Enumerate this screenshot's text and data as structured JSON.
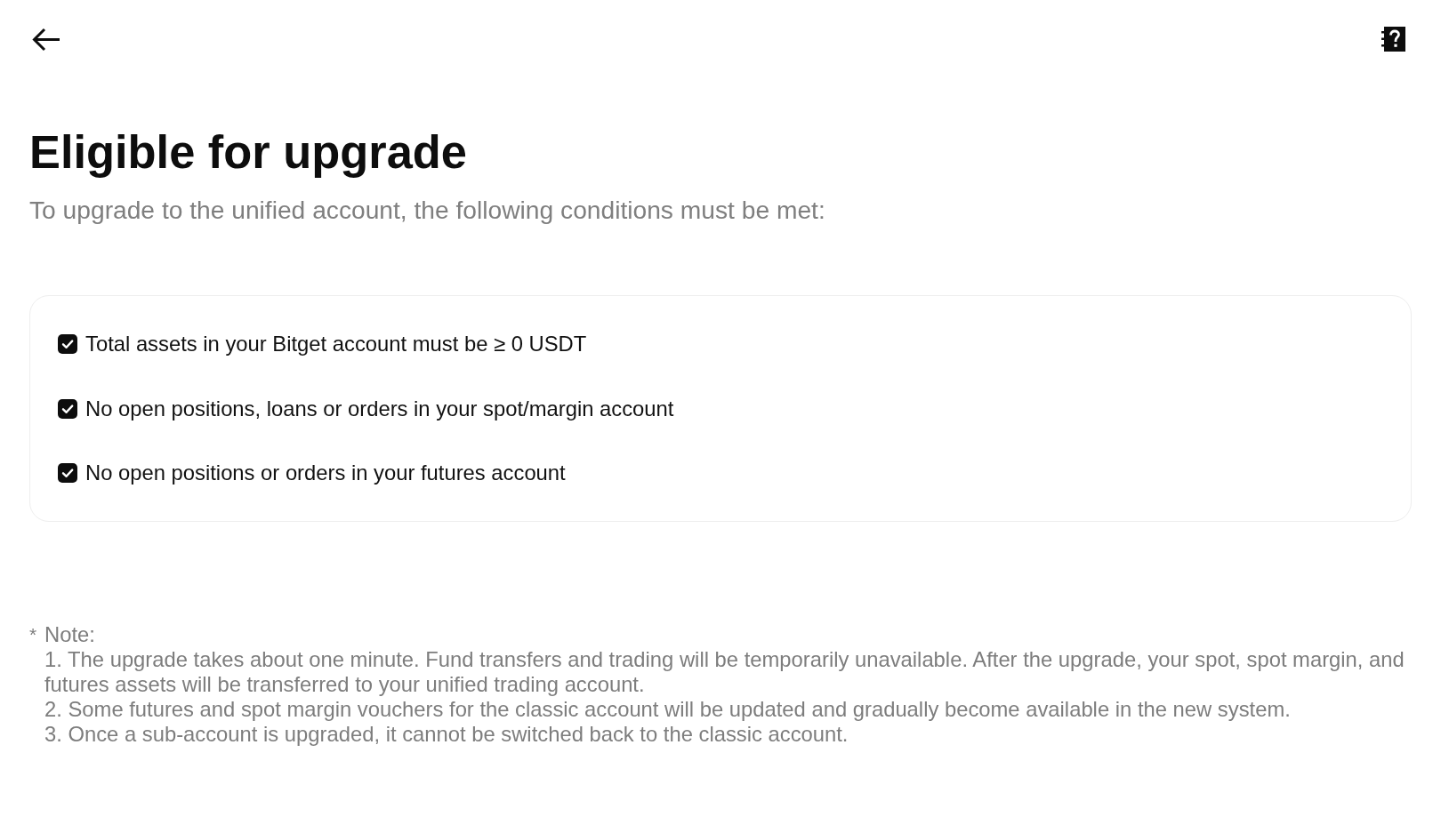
{
  "title": "Eligible for upgrade",
  "subtitle": "To upgrade to the unified account, the following conditions must be met:",
  "conditions": [
    {
      "label": "Total assets in your Bitget account must be ≥ 0 USDT",
      "checked": true
    },
    {
      "label": "No open positions, loans or orders in your spot/margin account",
      "checked": true
    },
    {
      "label": "No open positions or orders in your futures account",
      "checked": true
    }
  ],
  "note": {
    "marker": "*",
    "heading": "Note:",
    "items": [
      "1. The upgrade takes about one minute. Fund transfers and trading will be temporarily unavailable. After the upgrade, your spot, spot margin, and futures assets will be transferred to your unified trading account.",
      "2. Some futures and spot margin vouchers for the classic account will be updated and gradually become available in the new system.",
      "3. Once a sub-account is upgraded, it cannot be switched back to the classic account."
    ]
  }
}
